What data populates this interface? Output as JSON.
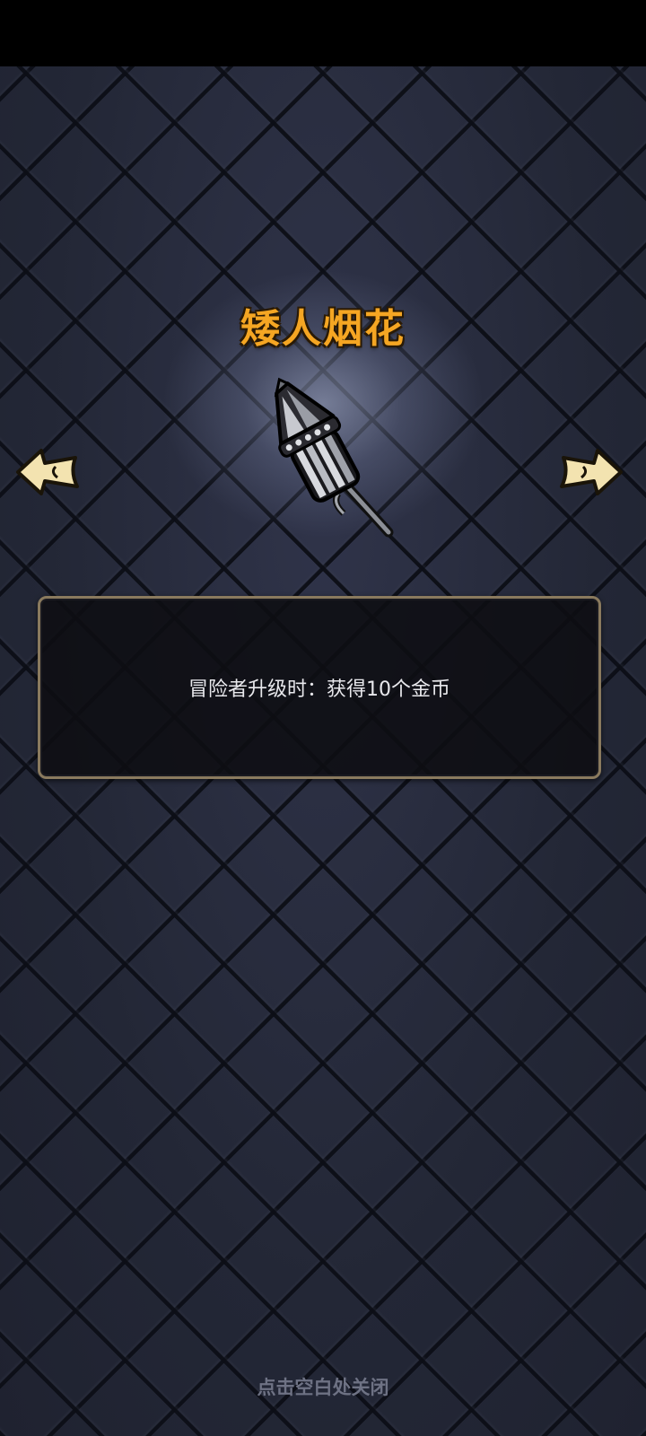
{
  "item": {
    "name": "矮人烟花",
    "icon": "firework-rocket-icon",
    "description": "冒险者升级时：获得10个金币"
  },
  "navigation": {
    "prev_icon": "arrow-left-icon",
    "next_icon": "arrow-right-icon"
  },
  "footer": {
    "close_hint": "点击空白处关闭"
  },
  "colors": {
    "title": "#f5a623",
    "panel_border": "#8a7a5e",
    "arrow_fill": "#f3e3b0",
    "background": "#262a38"
  }
}
